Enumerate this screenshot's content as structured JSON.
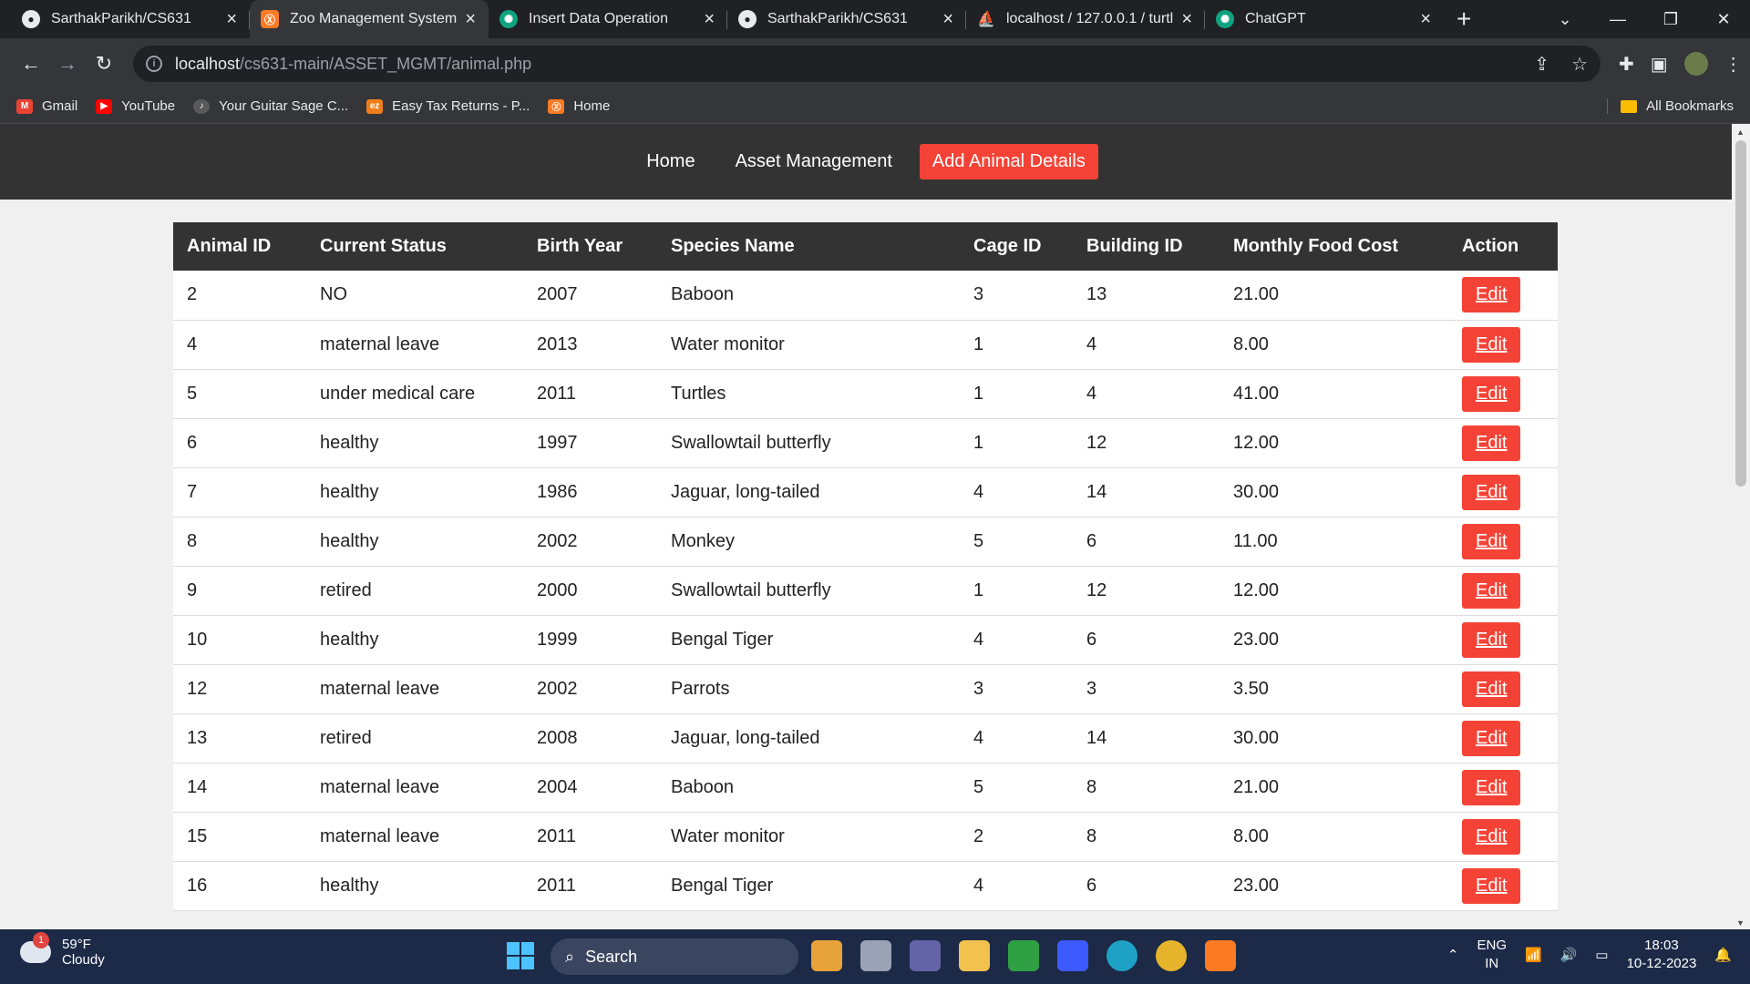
{
  "browser": {
    "tabs": [
      {
        "title": "SarthakParikh/CS631",
        "favicon": "github-icon",
        "active": false
      },
      {
        "title": "Zoo Management System",
        "favicon": "xampp-icon",
        "active": true
      },
      {
        "title": "Insert Data Operation",
        "favicon": "chatgpt-icon",
        "active": false
      },
      {
        "title": "SarthakParikh/CS631",
        "favicon": "github-icon",
        "active": false
      },
      {
        "title": "localhost / 127.0.0.1 / turtl",
        "favicon": "phpmyadmin-icon",
        "active": false
      },
      {
        "title": "ChatGPT",
        "favicon": "chatgpt-icon",
        "active": false
      }
    ],
    "url_host": "localhost",
    "url_path": "/cs631-main/ASSET_MGMT/animal.php",
    "bookmarks": [
      {
        "label": "Gmail"
      },
      {
        "label": "YouTube"
      },
      {
        "label": "Your Guitar Sage C..."
      },
      {
        "label": "Easy Tax Returns - P..."
      },
      {
        "label": "Home"
      }
    ],
    "all_bookmarks": "All Bookmarks"
  },
  "nav": {
    "home": "Home",
    "asset_management": "Asset Management",
    "add_animal": "Add Animal Details"
  },
  "table": {
    "headers": [
      "Animal ID",
      "Current Status",
      "Birth Year",
      "Species Name",
      "Cage ID",
      "Building ID",
      "Monthly Food Cost",
      "Action"
    ],
    "edit_label": "Edit",
    "rows": [
      {
        "id": "2",
        "status": "NO",
        "year": "2007",
        "species": "Baboon",
        "cage": "3",
        "building": "13",
        "cost": "21.00"
      },
      {
        "id": "4",
        "status": "maternal leave",
        "year": "2013",
        "species": "Water monitor",
        "cage": "1",
        "building": "4",
        "cost": "8.00"
      },
      {
        "id": "5",
        "status": "under medical care",
        "year": "2011",
        "species": "Turtles",
        "cage": "1",
        "building": "4",
        "cost": "41.00"
      },
      {
        "id": "6",
        "status": "healthy",
        "year": "1997",
        "species": "Swallowtail butterfly",
        "cage": "1",
        "building": "12",
        "cost": "12.00"
      },
      {
        "id": "7",
        "status": "healthy",
        "year": "1986",
        "species": "Jaguar, long-tailed",
        "cage": "4",
        "building": "14",
        "cost": "30.00"
      },
      {
        "id": "8",
        "status": "healthy",
        "year": "2002",
        "species": "Monkey",
        "cage": "5",
        "building": "6",
        "cost": "11.00"
      },
      {
        "id": "9",
        "status": "retired",
        "year": "2000",
        "species": "Swallowtail butterfly",
        "cage": "1",
        "building": "12",
        "cost": "12.00"
      },
      {
        "id": "10",
        "status": "healthy",
        "year": "1999",
        "species": "Bengal Tiger",
        "cage": "4",
        "building": "6",
        "cost": "23.00"
      },
      {
        "id": "12",
        "status": "maternal leave",
        "year": "2002",
        "species": "Parrots",
        "cage": "3",
        "building": "3",
        "cost": "3.50"
      },
      {
        "id": "13",
        "status": "retired",
        "year": "2008",
        "species": "Jaguar, long-tailed",
        "cage": "4",
        "building": "14",
        "cost": "30.00"
      },
      {
        "id": "14",
        "status": "maternal leave",
        "year": "2004",
        "species": "Baboon",
        "cage": "5",
        "building": "8",
        "cost": "21.00"
      },
      {
        "id": "15",
        "status": "maternal leave",
        "year": "2011",
        "species": "Water monitor",
        "cage": "2",
        "building": "8",
        "cost": "8.00"
      },
      {
        "id": "16",
        "status": "healthy",
        "year": "2011",
        "species": "Bengal Tiger",
        "cage": "4",
        "building": "6",
        "cost": "23.00"
      }
    ]
  },
  "taskbar": {
    "weather_temp": "59°F",
    "weather_desc": "Cloudy",
    "weather_badge": "1",
    "search_label": "Search",
    "lang_1": "ENG",
    "lang_2": "IN",
    "time": "18:03",
    "date": "10-12-2023"
  },
  "colors": {
    "nav_bg": "#333333",
    "accent": "#f44336",
    "page_bg": "#f0f0f0"
  }
}
